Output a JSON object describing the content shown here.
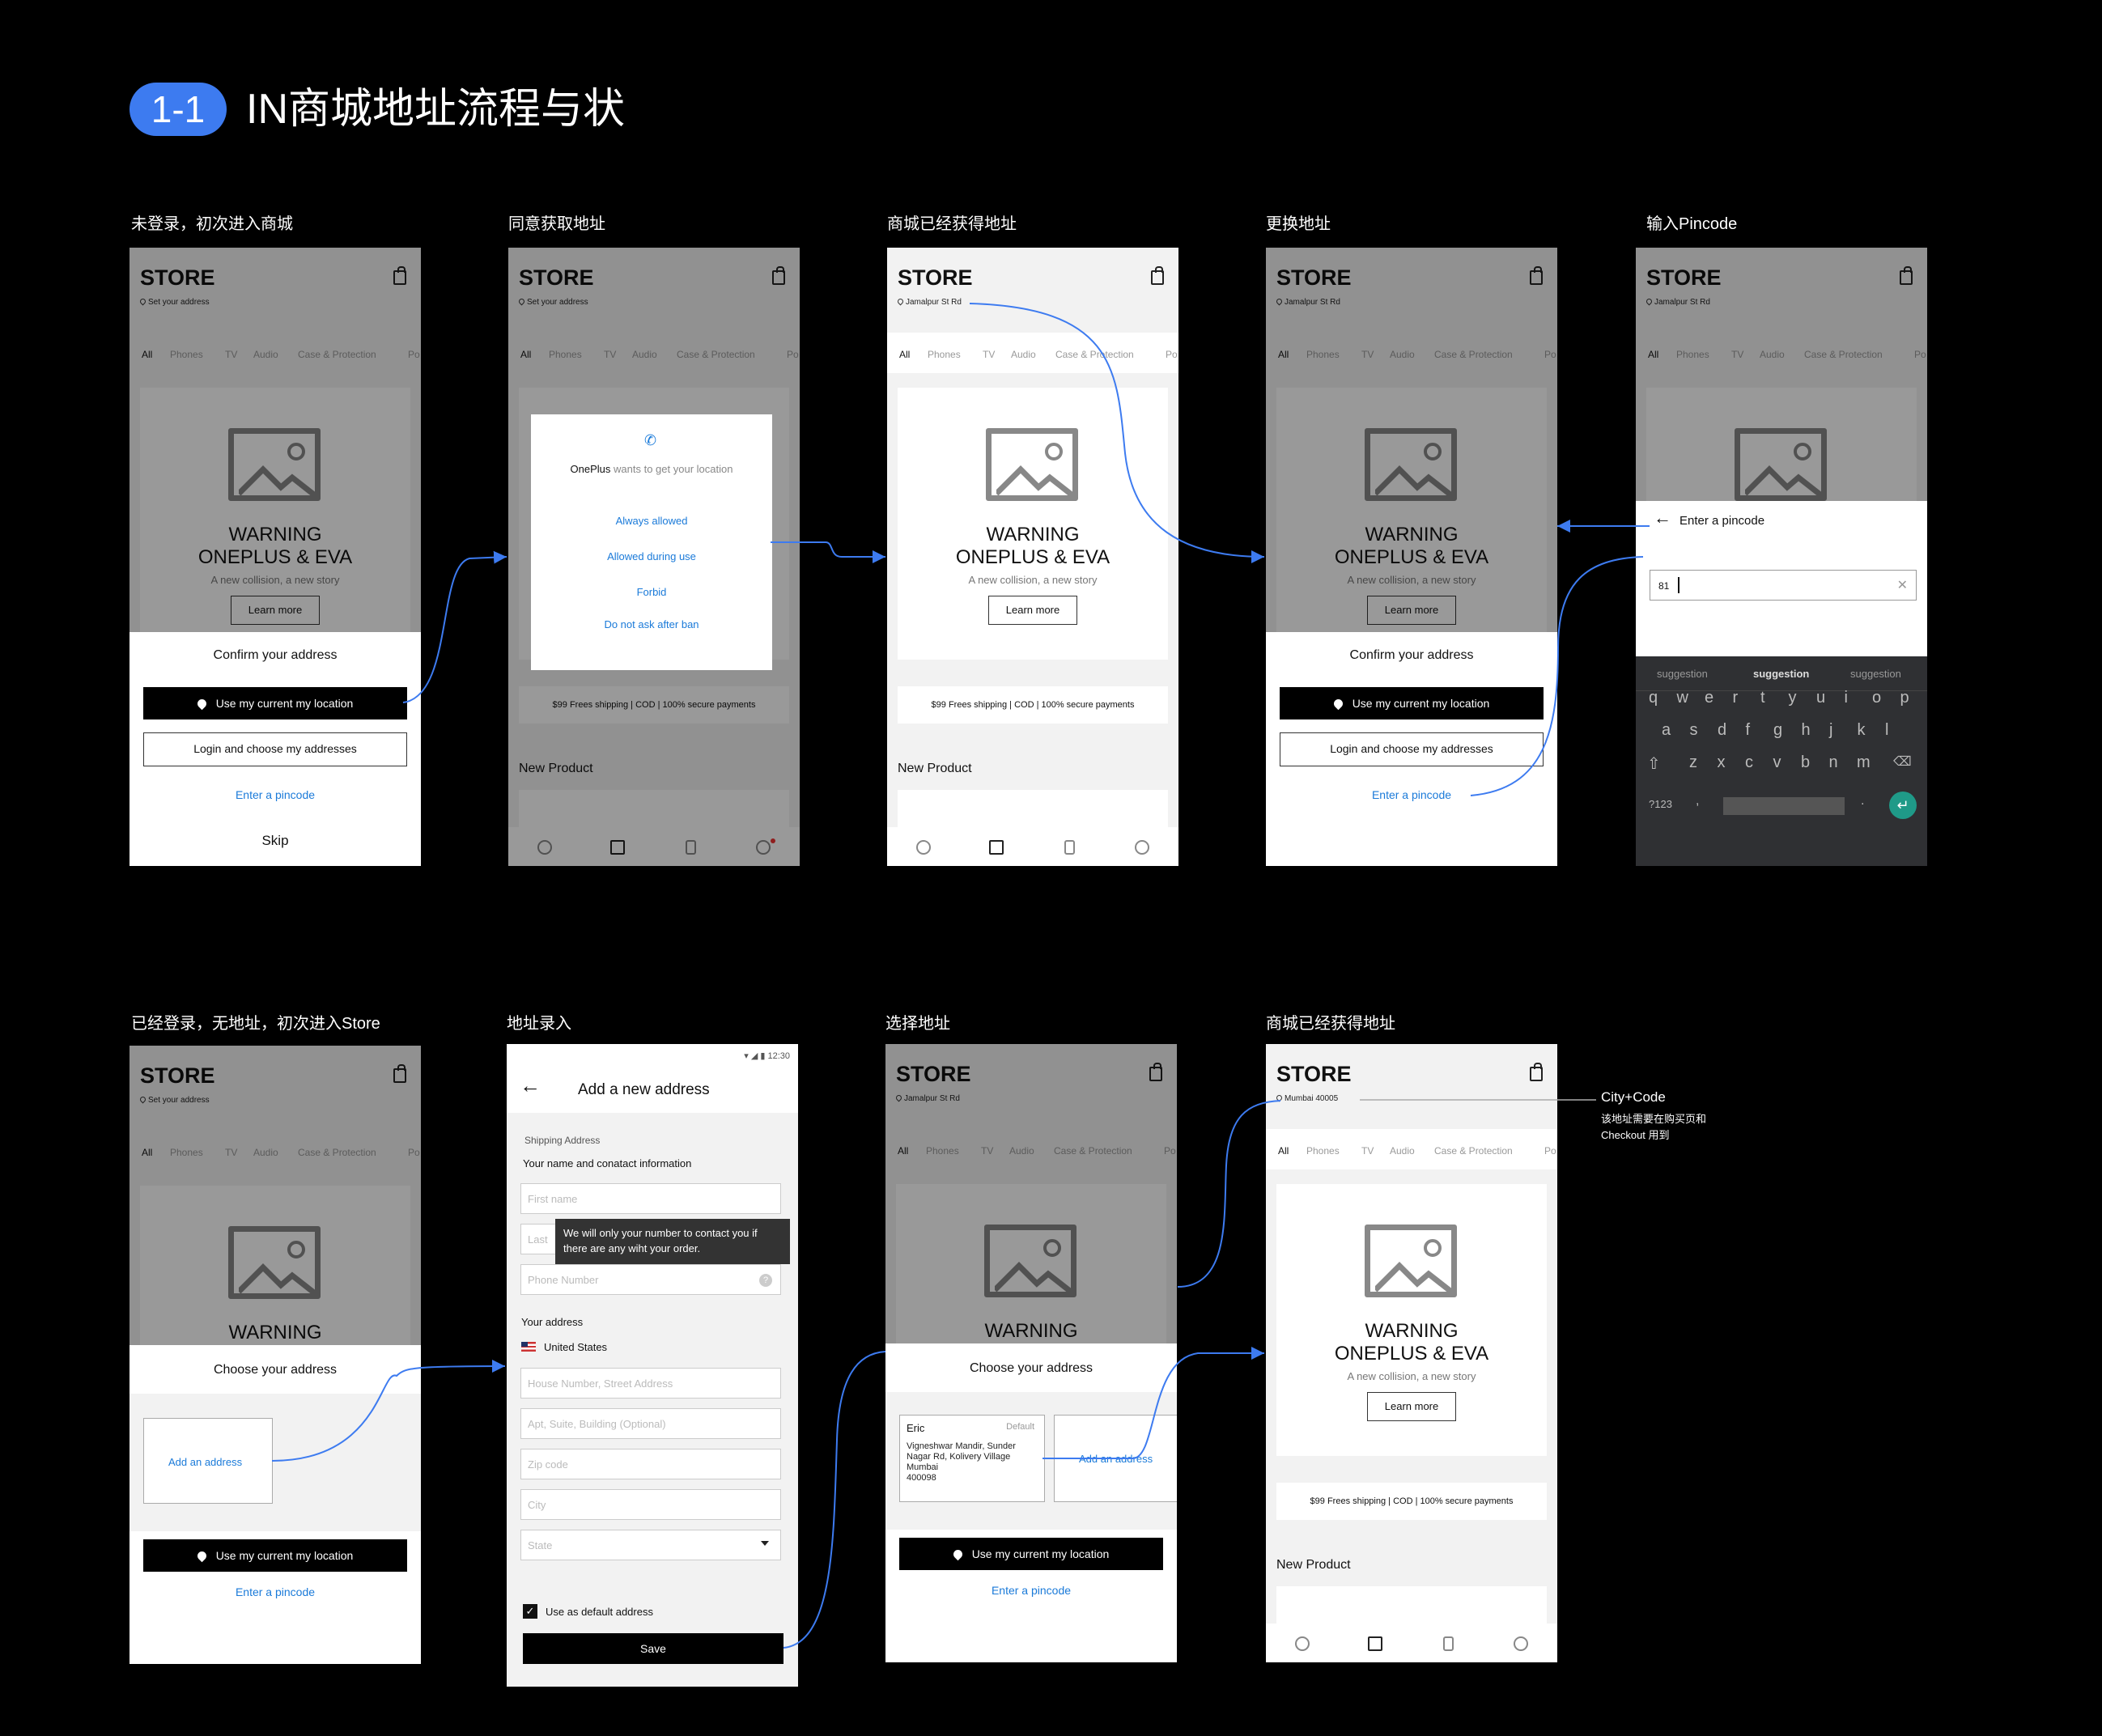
{
  "header": {
    "badge": "1-1",
    "title": "IN商城地址流程与状"
  },
  "labels": [
    "未登录，初次进入商城",
    "同意获取地址",
    "商城已经获得地址",
    "更换地址",
    "输入Pincode",
    "已经登录，无地址，初次进入Store",
    "地址录入",
    "选择地址",
    "商城已经获得地址"
  ],
  "common": {
    "store": "STORE",
    "set_address": "Set your address",
    "jamalpur": "Jamalpur St Rd",
    "mumbai": "Mumbai 40005",
    "tabs": [
      "All",
      "Phones",
      "TV",
      "Audio",
      "Case & Protection",
      "Po"
    ],
    "warning": "WARNING",
    "oneplus": "ONEPLUS & EVA",
    "tagline": "A new collision, a new story",
    "learn_more": "Learn more",
    "shipping": "$99 Frees shipping  |  COD  |  100% secure payments",
    "new_product": "New Product",
    "confirm_address": "Confirm your  address",
    "choose_address": "Choose your  address",
    "use_location": "Use my current  my location",
    "login_choose": "Login and choose my addresses",
    "enter_pincode": "Enter a pincode",
    "skip": "Skip",
    "add_address": "Add an address"
  },
  "permission": {
    "app": "OnePlus",
    "question": "wants to get your location",
    "options": [
      "Always allowed",
      "Allowed during use",
      "Forbid",
      "Do not ask after ban"
    ]
  },
  "pincode": {
    "title": "Enter a pincode",
    "value": "81",
    "suggestions": [
      "suggestion",
      "suggestion",
      "suggestion"
    ],
    "row1": [
      "q",
      "w",
      "e",
      "r",
      "t",
      "y",
      "u",
      "i",
      "o",
      "p"
    ],
    "row2": [
      "a",
      "s",
      "d",
      "f",
      "g",
      "h",
      "j",
      "k",
      "l"
    ],
    "row3": [
      "z",
      "x",
      "c",
      "v",
      "b",
      "n",
      "m"
    ],
    "sym": "?123",
    "comma": ",",
    "period": "."
  },
  "add_form": {
    "time": "12:30",
    "title": "Add a new  address",
    "section": "Shipping Address",
    "contact_label": "Your name and conatact information",
    "first_name": "First name",
    "last_name": "Last",
    "tooltip": "We will only your number to contact you if there are any wiht your order.",
    "phone": "Phone Number",
    "your_address": "Your address",
    "country": "United States",
    "street": "House Number, Street Address",
    "apt": "Apt, Suite, Building (Optional)",
    "zip": "Zip code",
    "city": "City",
    "state": "State",
    "default_addr": "Use as default address",
    "save": "Save"
  },
  "saved_address": {
    "name": "Eric",
    "tag": "Default",
    "line1": "Vigneshwar Mandir, Sunder",
    "line2": "Nagar Rd, Kolivery Village",
    "line3": "Mumbai",
    "line4": "400098"
  },
  "annotation": {
    "title": "City+Code",
    "line1": "该地址需要在购买页和",
    "line2": "Checkout 用到"
  },
  "colors": {
    "accent": "#3d7bf0",
    "link": "#1a7ad9",
    "background": "#000000"
  }
}
